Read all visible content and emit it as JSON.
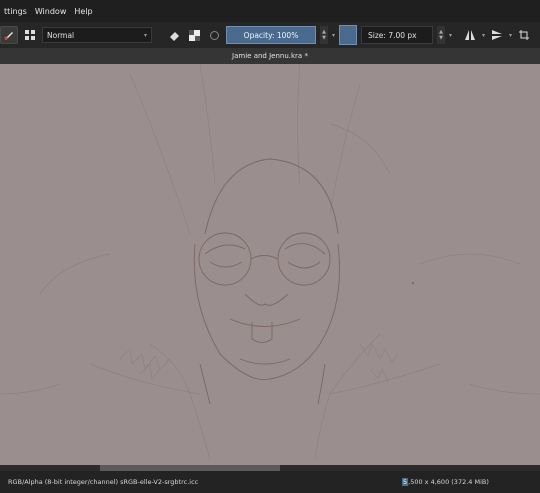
{
  "menu": {
    "items": [
      "ttings",
      "Window",
      "Help"
    ]
  },
  "toolbar": {
    "blend_mode": "Normal",
    "opacity_label": "Opacity: 100%",
    "size_label": "Size: 7.00 px",
    "accent_color": "#4a6a8e"
  },
  "document": {
    "title": "Jamie and Jennu.kra *"
  },
  "status": {
    "color_space": "RGB/Alpha (8-bit integer/channel)  sRGB-elle-V2-srgbtrc.icc",
    "dims_highlight": "5",
    "dims_rest": ",500 x 4,600 (372.4 MiB)"
  },
  "icons": [
    "brush-preset-icon",
    "pattern-grid-icon",
    "eraser-icon",
    "alpha-icon",
    "reload-icon",
    "mirror-horizontal-icon",
    "mirror-vertical-icon",
    "wrap-icon"
  ]
}
